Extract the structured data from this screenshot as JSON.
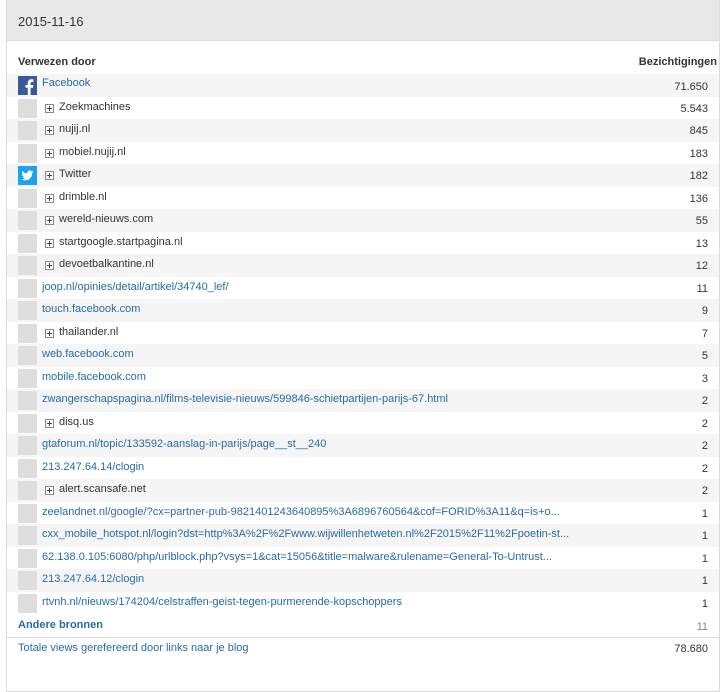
{
  "header": {
    "date": "2015-11-16"
  },
  "columns": {
    "referrer": "Verwezen door",
    "views": "Bezichtigingen"
  },
  "rows": [
    {
      "icon": "facebook-icon",
      "type": "link",
      "label": "Facebook",
      "count": "71.650"
    },
    {
      "icon": "",
      "type": "group",
      "label": "Zoekmachines",
      "count": "5.543"
    },
    {
      "icon": "",
      "type": "group",
      "label": "nujij.nl",
      "count": "845"
    },
    {
      "icon": "",
      "type": "group",
      "label": "mobiel.nujij.nl",
      "count": "183"
    },
    {
      "icon": "twitter-icon",
      "type": "group",
      "label": "Twitter",
      "count": "182"
    },
    {
      "icon": "",
      "type": "group",
      "label": "drimble.nl",
      "count": "136"
    },
    {
      "icon": "",
      "type": "group",
      "label": "wereld-nieuws.com",
      "count": "55"
    },
    {
      "icon": "",
      "type": "group",
      "label": "startgoogle.startpagina.nl",
      "count": "13"
    },
    {
      "icon": "",
      "type": "group",
      "label": "devoetbalkantine.nl",
      "count": "12"
    },
    {
      "icon": "",
      "type": "link",
      "label": "joop.nl/opinies/detail/artikel/34740_lef/",
      "count": "11"
    },
    {
      "icon": "",
      "type": "link",
      "label": "touch.facebook.com",
      "count": "9"
    },
    {
      "icon": "",
      "type": "group",
      "label": "thailander.nl",
      "count": "7"
    },
    {
      "icon": "",
      "type": "link",
      "label": "web.facebook.com",
      "count": "5"
    },
    {
      "icon": "",
      "type": "link",
      "label": "mobile.facebook.com",
      "count": "3"
    },
    {
      "icon": "",
      "type": "link",
      "label": "zwangerschapspagina.nl/films-televisie-nieuws/599846-schietpartijen-parijs-67.html",
      "count": "2"
    },
    {
      "icon": "",
      "type": "group",
      "label": "disq.us",
      "count": "2"
    },
    {
      "icon": "",
      "type": "link",
      "label": "gtaforum.nl/topic/133592-aanslag-in-parijs/page__st__240",
      "count": "2"
    },
    {
      "icon": "",
      "type": "link",
      "label": "213.247.64.14/clogin",
      "count": "2"
    },
    {
      "icon": "",
      "type": "group",
      "label": "alert.scansafe.net",
      "count": "2"
    },
    {
      "icon": "",
      "type": "link",
      "label": "zeelandnet.nl/google/?cx=partner-pub-9821401243640895%3A6896760564&cof=FORID%3A11&q=is+o...",
      "count": "1"
    },
    {
      "icon": "",
      "type": "link",
      "label": "cxx_mobile_hotspot.nl/login?dst=http%3A%2F%2Fwww.wijwillenhetweten.nl%2F2015%2F11%2Fpoetin-st...",
      "count": "1"
    },
    {
      "icon": "",
      "type": "link",
      "label": "62.138.0.105:6080/php/urlblock.php?vsys=1&cat=15056&title=malware&rulename=General-To-Untrust...",
      "count": "1"
    },
    {
      "icon": "",
      "type": "link",
      "label": "213.247.64.12/clogin",
      "count": "1"
    },
    {
      "icon": "",
      "type": "link",
      "label": "rtvnh.nl/nieuws/174204/celstraffen-geist-tegen-purmerende-kopschoppers",
      "count": "1"
    }
  ],
  "other": {
    "label": "Andere bronnen",
    "count": "11"
  },
  "total": {
    "label": "Totale views gerefereerd door links naar je blog",
    "count": "78.680"
  },
  "colors": {
    "link": "#2a6aa8",
    "facebook": "#3b5998",
    "twitter": "#1da1f2",
    "header_bg": "#e8e8e8",
    "row_alt": "#f5f5f5"
  }
}
